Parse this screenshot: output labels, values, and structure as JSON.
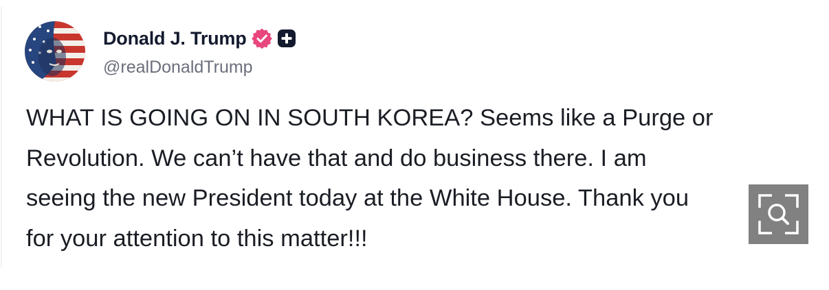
{
  "author": {
    "display_name": "Donald J. Trump",
    "handle": "@realDonaldTrump",
    "avatar_icon": "flag-portrait-avatar",
    "verified_icon": "verified-badge-icon",
    "verified_color": "#e8467c",
    "plus_icon": "plus-badge-icon"
  },
  "post": {
    "lines": [
      "WHAT IS GOING ON IN SOUTH KOREA? Seems like a Purge or",
      "Revolution. We can’t have that and do business there. I am",
      "seeing the new President today at the White House. Thank you",
      "for your attention to this matter!!!"
    ]
  },
  "overlay": {
    "zoom_icon": "zoom-magnifier-icon",
    "background": "#767676"
  }
}
